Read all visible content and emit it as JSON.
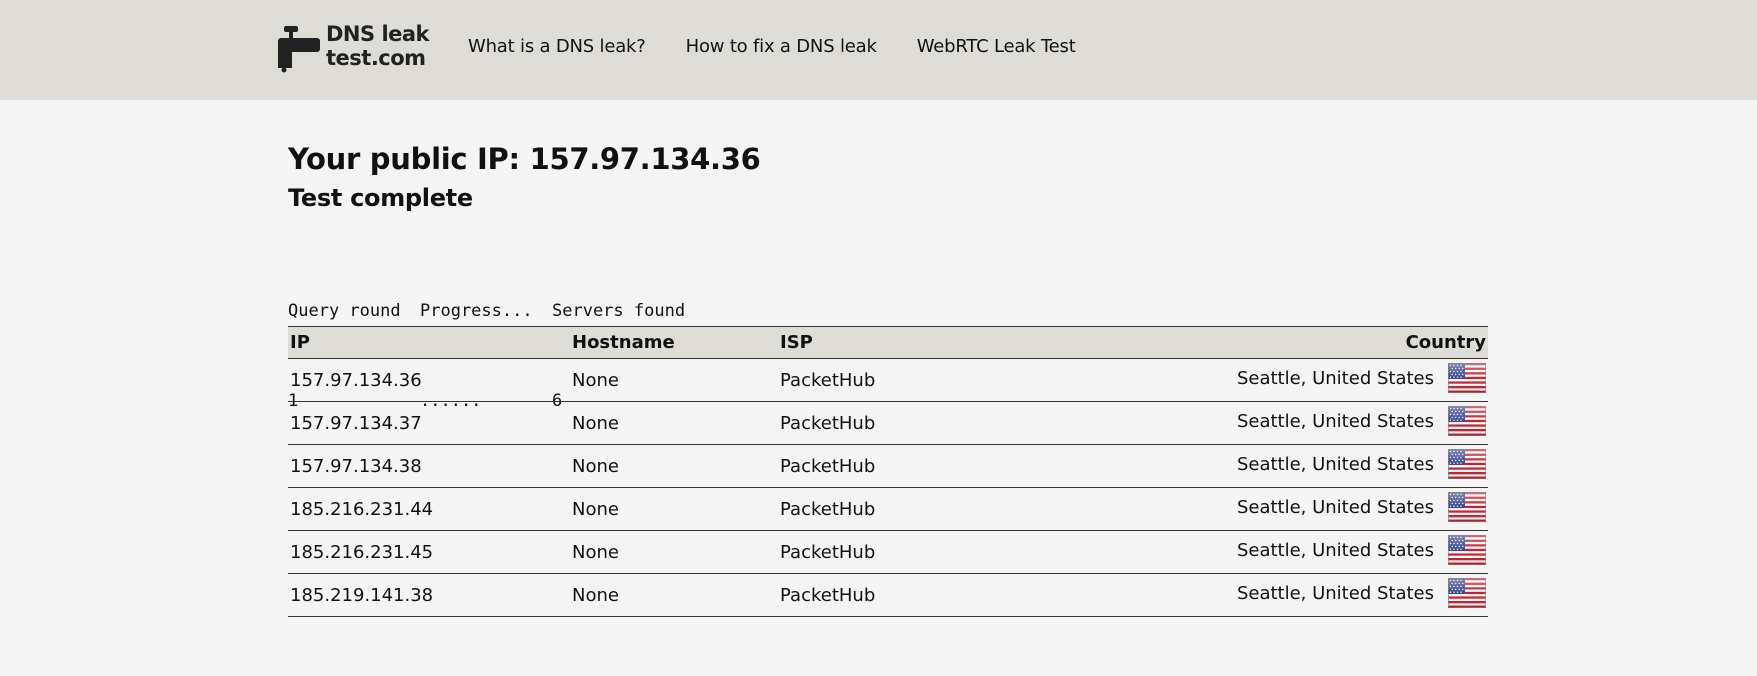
{
  "header": {
    "logo_line1": "DNS leak",
    "logo_line2": "test.com",
    "nav": [
      {
        "label": "What is a DNS leak?"
      },
      {
        "label": "How to fix a DNS leak"
      },
      {
        "label": "WebRTC Leak Test"
      }
    ]
  },
  "main": {
    "ip_heading": "Your public IP: 157.97.134.36",
    "status": "Test complete",
    "progress": {
      "headers": [
        "Query round",
        "Progress...",
        "Servers found"
      ],
      "values": [
        "1",
        "......",
        "6"
      ]
    },
    "table": {
      "columns": [
        "IP",
        "Hostname",
        "ISP",
        "Country"
      ],
      "rows": [
        {
          "ip": "157.97.134.36",
          "hostname": "None",
          "isp": "PacketHub",
          "country": "Seattle, United States",
          "flag": "us-flag-icon"
        },
        {
          "ip": "157.97.134.37",
          "hostname": "None",
          "isp": "PacketHub",
          "country": "Seattle, United States",
          "flag": "us-flag-icon"
        },
        {
          "ip": "157.97.134.38",
          "hostname": "None",
          "isp": "PacketHub",
          "country": "Seattle, United States",
          "flag": "us-flag-icon"
        },
        {
          "ip": "185.216.231.44",
          "hostname": "None",
          "isp": "PacketHub",
          "country": "Seattle, United States",
          "flag": "us-flag-icon"
        },
        {
          "ip": "185.216.231.45",
          "hostname": "None",
          "isp": "PacketHub",
          "country": "Seattle, United States",
          "flag": "us-flag-icon"
        },
        {
          "ip": "185.219.141.38",
          "hostname": "None",
          "isp": "PacketHub",
          "country": "Seattle, United States",
          "flag": "us-flag-icon"
        }
      ]
    }
  },
  "colors": {
    "header_bg": "#dddcd7",
    "page_bg": "#f4f4f4",
    "text": "#111111"
  }
}
